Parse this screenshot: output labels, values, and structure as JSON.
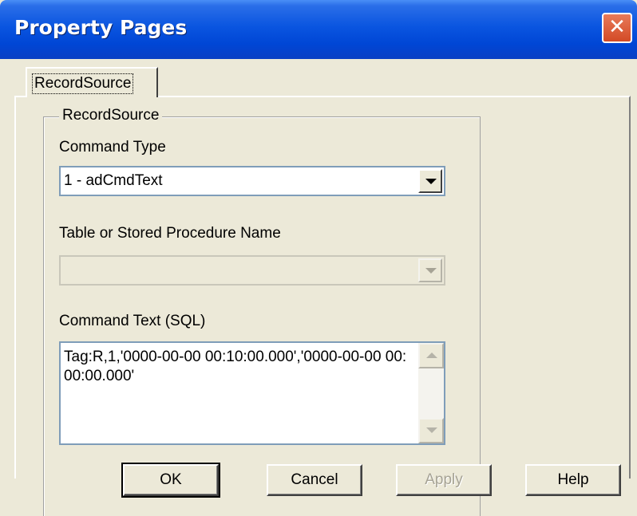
{
  "window": {
    "title": "Property Pages",
    "close_glyph": "✕"
  },
  "tabs": [
    {
      "label": "RecordSource",
      "active": true
    }
  ],
  "group": {
    "legend": "RecordSource"
  },
  "command_type": {
    "label": "Command Type",
    "value": "1 - adCmdText"
  },
  "table_name": {
    "label": "Table or Stored Procedure Name",
    "value": "",
    "enabled": false
  },
  "command_text": {
    "label": "Command Text (SQL)",
    "value": "Tag:R,1,'0000-00-00 00:10:00.000','0000-00-00 00:00:00.000'"
  },
  "buttons": {
    "ok": "OK",
    "cancel": "Cancel",
    "apply": "Apply",
    "help": "Help"
  },
  "colors": {
    "titlebar": "#0a55e0",
    "close": "#d34a25",
    "face": "#ece9d8"
  }
}
